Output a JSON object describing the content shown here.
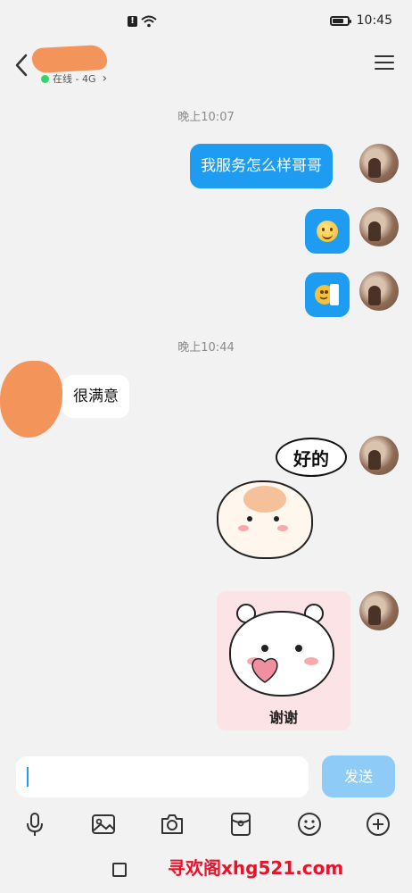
{
  "status_bar": {
    "time": "10:45"
  },
  "header": {
    "online_status": "在线 - 4G",
    "online_chevron": "›"
  },
  "messages": [
    {
      "type": "time",
      "text": "晚上10:07"
    },
    {
      "type": "text",
      "side": "out",
      "text": "我服务怎么样哥哥"
    },
    {
      "type": "emoji",
      "side": "out",
      "icon": "smile-emoji"
    },
    {
      "type": "emoji",
      "side": "out",
      "icon": "peek-emoji"
    },
    {
      "type": "time",
      "text": "晚上10:44"
    },
    {
      "type": "text",
      "side": "in",
      "text": "很满意"
    },
    {
      "type": "sticker",
      "side": "out",
      "text": "好的"
    },
    {
      "type": "sticker",
      "side": "out",
      "text": "谢谢"
    }
  ],
  "input": {
    "value": "",
    "placeholder": ""
  },
  "send_button": {
    "label": "发送"
  },
  "toolbar": {
    "icons": [
      "microphone-icon",
      "image-icon",
      "camera-icon",
      "red-packet-icon",
      "emoji-icon",
      "plus-icon"
    ]
  },
  "watermark": {
    "text": "寻欢阁xhg521.com"
  },
  "colors": {
    "bubble_out": "#1e9cf2",
    "send_disabled": "#8ecbf7",
    "online": "#35d36b",
    "watermark": "#e8132b"
  }
}
